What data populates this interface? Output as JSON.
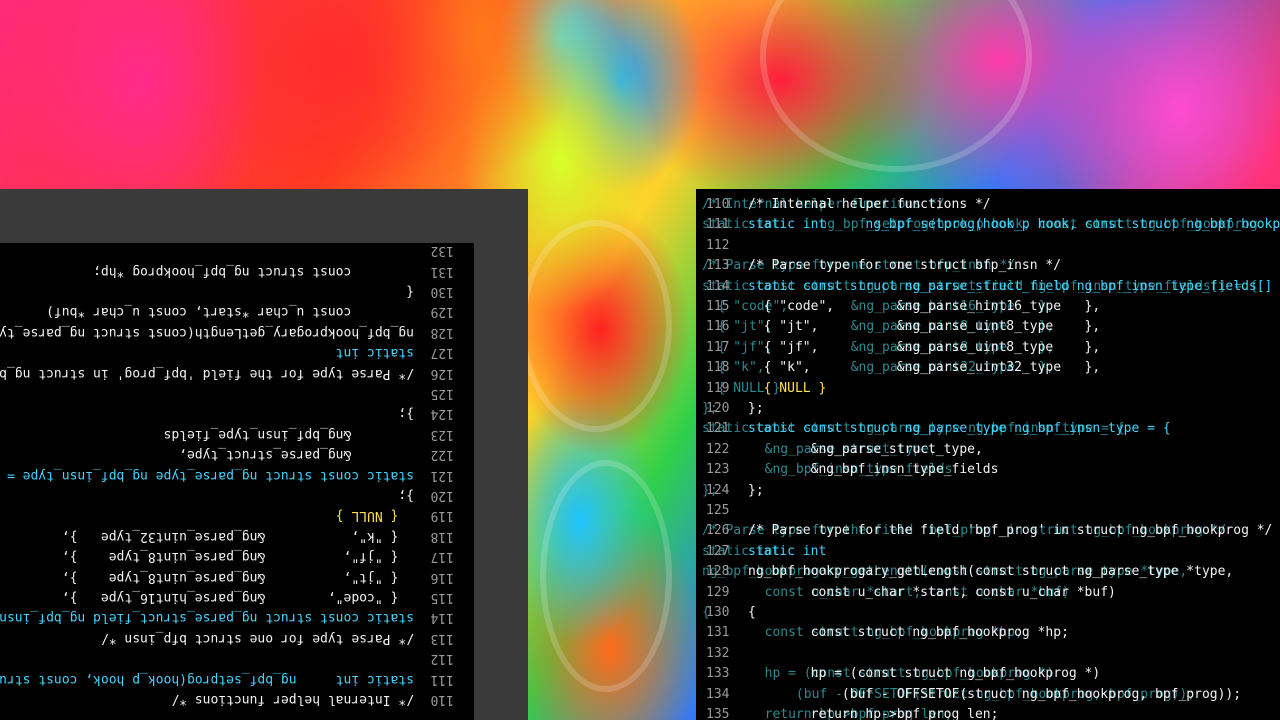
{
  "left_pane": {
    "line_numbers": [
      "110",
      "111",
      "112",
      "113",
      "114",
      "115",
      "116",
      "117",
      "118",
      "119",
      "120",
      "121",
      "122",
      "123",
      "124",
      "125",
      "126",
      "127",
      "128",
      "129",
      "130",
      "131",
      "132"
    ],
    "code": [
      "/* Internal helper functions */",
      "static int     ng_bpf_setprog(hook_p hook, const struct",
      "",
      "/* Parse type for one struct bfp_insn */",
      "static const struct ng_parse_struct_field ng_bpf_insn_type",
      "  { \"code\",        &ng_parse_hint16_type   },",
      "  { \"jt\",          &ng_parse_uint8_type    },",
      "  { \"jf\",          &ng_parse_uint8_type    },",
      "  { \"k\",           &ng_parse_uint32_type   },",
      "  { NULL }",
      "};",
      "static const struct ng_parse_type ng_bpf_insn_type = {",
      "        &ng_parse_struct_type,",
      "        &ng_bpf_insn_type_fields",
      "};",
      "",
      "/* Parse type for the field 'bpf_prog' in struct ng_bpf_ho",
      "static int",
      "ng_bpf_hookprogary_getLength(const struct ng_parse_type *",
      "        const u_char *start, const u_char *buf)",
      "{",
      "        const struct ng_bpf_hookprog *hp;",
      ""
    ]
  },
  "right_pane": {
    "line_numbers": [
      "110",
      "111",
      "112",
      "113",
      "114",
      "115",
      "116",
      "117",
      "118",
      "119",
      "120",
      "121",
      "122",
      "123",
      "124",
      "125",
      "126",
      "127",
      "128",
      "129",
      "130",
      "131",
      "132",
      "133",
      "134",
      "135"
    ],
    "code": [
      "/* Internal helper functions */",
      "static int     ng_bpf_setprog(hook_p hook, const struct ng_bpf_hookprog",
      "",
      "/* Parse type for one struct bfp_insn */",
      "static const struct ng_parse_struct_field ng_bpf_insn_type_fields[] = {",
      "  { \"code\",        &ng_parse_hint16_type   },",
      "  { \"jt\",          &ng_parse_uint8_type    },",
      "  { \"jf\",          &ng_parse_uint8_type    },",
      "  { \"k\",           &ng_parse_uint32_type   },",
      "  { NULL }",
      "};",
      "static const struct ng_parse_type ng_bpf_insn_type = {",
      "        &ng_parse_struct_type,",
      "        &ng_bpf_insn_type_fields",
      "};",
      "",
      "/* Parse type for the field 'bpf_prog' in struct ng_bpf_hookprog */",
      "static int",
      "ng_bpf_hookprogary_getLength(const struct ng_parse_type *type,",
      "        const u_char *start, const u_char *buf)",
      "{",
      "        const struct ng_bpf_hookprog *hp;",
      "",
      "        hp = (const struct ng_bpf_hookprog *)",
      "            (buf - OFFSETOF(struct ng_bpf_hookprog, bpf_prog));",
      "        return hp->bpf_prog_len;"
    ]
  }
}
